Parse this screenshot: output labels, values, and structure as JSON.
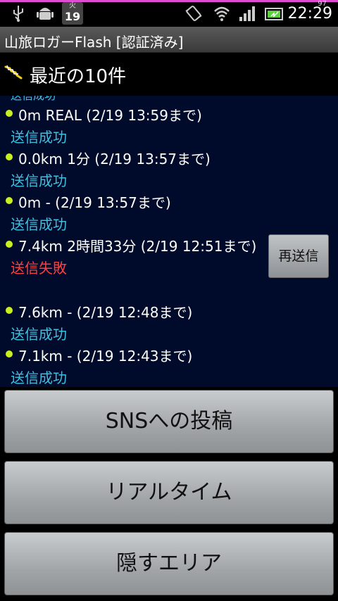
{
  "status_bar": {
    "calendar_dow": "火",
    "calendar_day": "19",
    "battery_percent": "97",
    "time": "22:29",
    "icons": [
      "usb-icon",
      "android-debug-icon",
      "calendar-icon",
      "vibrate-icon",
      "wifi-icon",
      "signal-icon",
      "battery-icon"
    ]
  },
  "app": {
    "title": "山旅ロガーFlash [認証済み]"
  },
  "recent": {
    "title": "最近の10件"
  },
  "log": {
    "partial_top_status": "送信成功",
    "entries": [
      {
        "line": "0m REAL (2/19 13:59まで)",
        "status": "送信成功",
        "state": "ok"
      },
      {
        "line": "0.0km 1分 (2/19 13:57まで)",
        "status": "送信成功",
        "state": "ok"
      },
      {
        "line": "0m - (2/19 13:57まで)",
        "status": "送信成功",
        "state": "ok"
      },
      {
        "line": "7.4km 2時間33分 (2/19 12:51まで)",
        "status": "送信失敗",
        "state": "fail"
      },
      {
        "line": "7.6km - (2/19 12:48まで)",
        "status": "送信成功",
        "state": "ok"
      },
      {
        "line": "7.1km - (2/19 12:43まで)",
        "status": "送信成功",
        "state": "ok"
      }
    ],
    "resend_label": "再送信"
  },
  "buttons": {
    "sns_post": "SNSへの投稿",
    "realtime": "リアルタイム",
    "hide_area": "隠すエリア"
  },
  "colors": {
    "ok": "#3fc0e0",
    "fail": "#ff4040",
    "bullet": "#c8f020",
    "list_bg": "#000a2a",
    "status_bar_accent": "#e24bd2"
  }
}
